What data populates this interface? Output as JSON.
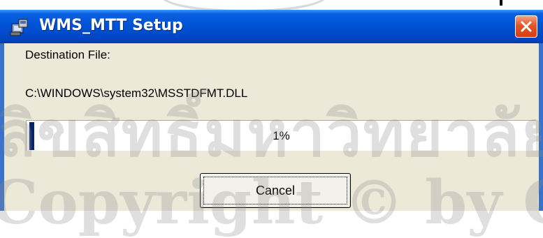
{
  "window": {
    "title": "WMS_MTT Setup",
    "close_label": "Close"
  },
  "status": {
    "destination_label": "Destination File:",
    "destination_path": "C:\\WINDOWS\\system32\\MSSTDFMT.DLL"
  },
  "progress": {
    "percent": 1,
    "text": "1%"
  },
  "buttons": {
    "cancel_label": "Cancel"
  },
  "watermark": {
    "line1": "ลิขสิทธิ์มหาวิทยาลัยเชียงใหม่",
    "line2": "Copyright © by Chiang Mai University"
  },
  "colors": {
    "titlebar": "#0053d6",
    "client_bg": "#ece9d8",
    "progress_fill": "#0a246a",
    "close_button": "#e2552b"
  }
}
